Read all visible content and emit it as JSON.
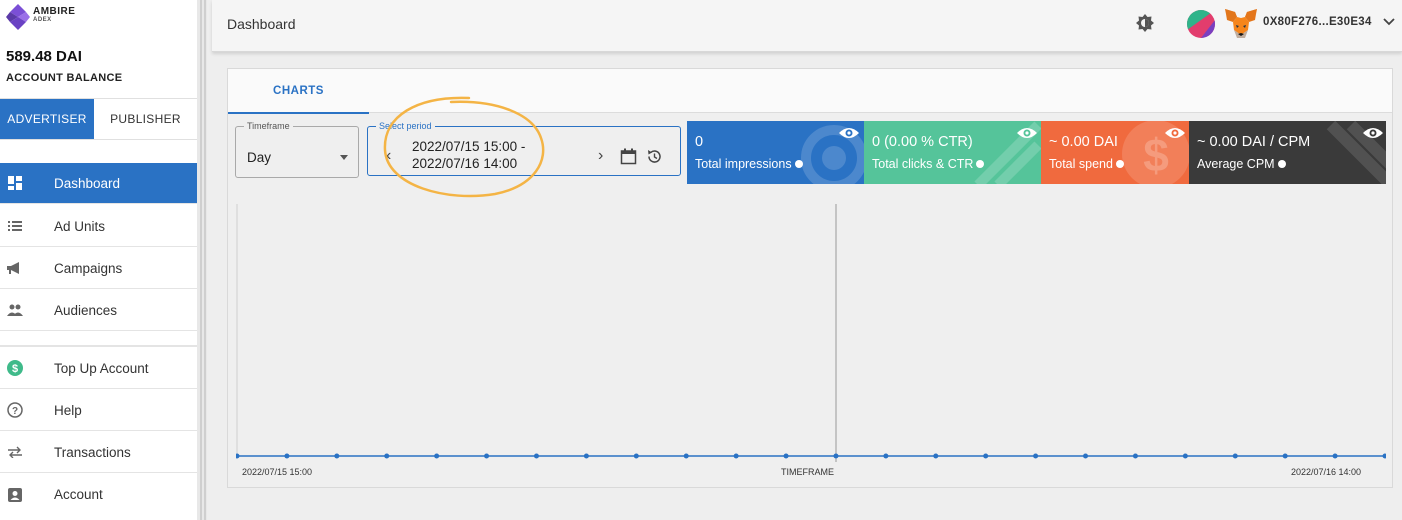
{
  "brand": {
    "name": "AMBIRE",
    "sub": "ADEX"
  },
  "account": {
    "balance": "589.48 DAI",
    "balance_label": "ACCOUNT BALANCE"
  },
  "roles": {
    "advertiser": "ADVERTISER",
    "publisher": "PUBLISHER"
  },
  "nav": {
    "dashboard": "Dashboard",
    "ad_units": "Ad Units",
    "campaigns": "Campaigns",
    "audiences": "Audiences",
    "top_up": "Top Up Account",
    "help": "Help",
    "transactions": "Transactions",
    "account": "Account"
  },
  "header": {
    "title": "Dashboard",
    "address": "0X80F276...E30E34"
  },
  "tabs": {
    "charts": "CHARTS"
  },
  "filters": {
    "timeframe_label": "Timeframe",
    "timeframe_value": "Day",
    "period_label": "Select period",
    "period_start": "2022/07/15 15:00 -",
    "period_end": "2022/07/16 14:00"
  },
  "stats": [
    {
      "value": "0",
      "label": "Total impressions",
      "color": "#2a72c4"
    },
    {
      "value": "0 (0.00 % CTR)",
      "label": "Total clicks & CTR",
      "color": "#55c49a"
    },
    {
      "value": "~ 0.00 DAI",
      "label": "Total spend",
      "color": "#f06a3e"
    },
    {
      "value": "~ 0.00 DAI / CPM",
      "label": "Average CPM",
      "color": "#3a3a3a"
    }
  ],
  "chart_data": {
    "type": "line",
    "x_start_label": "2022/07/15 15:00",
    "x_end_label": "2022/07/16 14:00",
    "xlabel": "TIMEFRAME",
    "points": 24,
    "values": [
      0,
      0,
      0,
      0,
      0,
      0,
      0,
      0,
      0,
      0,
      0,
      0,
      0,
      0,
      0,
      0,
      0,
      0,
      0,
      0,
      0,
      0,
      0,
      0
    ],
    "line_color": "#2a72c4"
  }
}
